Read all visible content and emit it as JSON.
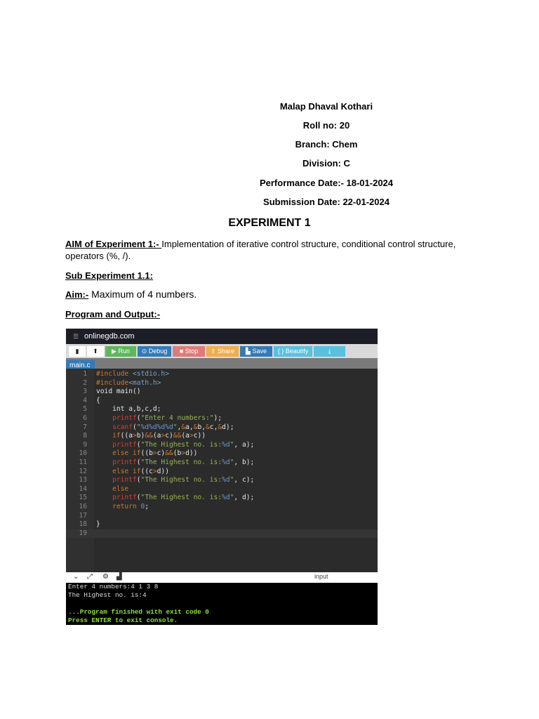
{
  "header": {
    "name": "Malap Dhaval Kothari",
    "roll": "Roll no: 20",
    "branch": "Branch: Chem",
    "division": "Division: C",
    "performance_date": "Performance Date:- 18-01-2024",
    "submission_date": "Submission Date: 22-01-2024"
  },
  "title": "EXPERIMENT 1",
  "aim": {
    "label": " AIM of Experiment 1:- ",
    "text": "Implementation of iterative control structure, conditional control structure, operators (%, /)."
  },
  "sub_experiment": " Sub Experiment 1.1:",
  "sub_aim": {
    "label": " Aim:-",
    "text": " Maximum of 4 numbers."
  },
  "program_output_label": "Program and Output:-",
  "screenshot": {
    "site": "onlinegdb.com",
    "toolbar": {
      "run": "▶ Run",
      "debug": "⊙ Debug",
      "stop": "■ Stop",
      "share": "⇪ Share",
      "save": "▙ Save",
      "beautify": "{ } Beautify",
      "download": "⤓"
    },
    "colors": {
      "run": "#5cb85c",
      "debug": "#337ab7",
      "stop": "#e07b7b",
      "share": "#f0ad4e",
      "save": "#337ab7",
      "beautify": "#5bc0de",
      "download": "#5bc0de"
    },
    "tab": "main.c",
    "code_lines": [
      [
        [
          "pp",
          "#include "
        ],
        [
          "inc",
          "<stdio.h>"
        ]
      ],
      [
        [
          "pp",
          "#include"
        ],
        [
          "inc",
          "<math.h>"
        ]
      ],
      [
        [
          "plain",
          "void main()"
        ]
      ],
      [
        [
          "plain",
          "{"
        ]
      ],
      [
        [
          "plain",
          "    int a,b,c,d;"
        ]
      ],
      [
        [
          "fn",
          "    printf"
        ],
        [
          "plain",
          "("
        ],
        [
          "str",
          "\"Enter 4 numbers:\""
        ],
        [
          "plain",
          ");"
        ]
      ],
      [
        [
          "fn",
          "    scanf"
        ],
        [
          "plain",
          "("
        ],
        [
          "str",
          "\""
        ],
        [
          "fmt",
          "%d%d%d%d"
        ],
        [
          "str",
          "\""
        ],
        [
          "plain",
          ","
        ],
        [
          "op",
          "&"
        ],
        [
          "plain",
          "a,"
        ],
        [
          "op",
          "&"
        ],
        [
          "plain",
          "b,"
        ],
        [
          "op",
          "&"
        ],
        [
          "plain",
          "c,"
        ],
        [
          "op",
          "&"
        ],
        [
          "plain",
          "d);"
        ]
      ],
      [
        [
          "kw",
          "    if"
        ],
        [
          "plain",
          "((a"
        ],
        [
          "op",
          ">"
        ],
        [
          "plain",
          "b)"
        ],
        [
          "op",
          "&&"
        ],
        [
          "plain",
          "(a"
        ],
        [
          "op",
          ">"
        ],
        [
          "plain",
          "c)"
        ],
        [
          "op",
          "&&"
        ],
        [
          "plain",
          "(a"
        ],
        [
          "op",
          ">"
        ],
        [
          "plain",
          "c))"
        ]
      ],
      [
        [
          "fn",
          "    printf"
        ],
        [
          "plain",
          "("
        ],
        [
          "str",
          "\"The Highest no. is:"
        ],
        [
          "fmt",
          "%d"
        ],
        [
          "str",
          "\""
        ],
        [
          "plain",
          ", a);"
        ]
      ],
      [
        [
          "kw",
          "    else if"
        ],
        [
          "plain",
          "((b"
        ],
        [
          "op",
          ">"
        ],
        [
          "plain",
          "c)"
        ],
        [
          "op",
          "&&"
        ],
        [
          "plain",
          "(b"
        ],
        [
          "op",
          ">"
        ],
        [
          "plain",
          "d))"
        ]
      ],
      [
        [
          "fn",
          "    printf"
        ],
        [
          "plain",
          "("
        ],
        [
          "str",
          "\"The Highest no. is:"
        ],
        [
          "fmt",
          "%d"
        ],
        [
          "str",
          "\""
        ],
        [
          "plain",
          ", b);"
        ]
      ],
      [
        [
          "kw",
          "    else if"
        ],
        [
          "plain",
          "((c"
        ],
        [
          "op",
          ">"
        ],
        [
          "plain",
          "d))"
        ]
      ],
      [
        [
          "fn",
          "    printf"
        ],
        [
          "plain",
          "("
        ],
        [
          "str",
          "\"The Highest no. is:"
        ],
        [
          "fmt",
          "%d"
        ],
        [
          "str",
          "\""
        ],
        [
          "plain",
          ", c);"
        ]
      ],
      [
        [
          "kw",
          "    else"
        ]
      ],
      [
        [
          "fn",
          "    printf"
        ],
        [
          "plain",
          "("
        ],
        [
          "str",
          "\"The Highest no. is:"
        ],
        [
          "fmt",
          "%d"
        ],
        [
          "str",
          "\""
        ],
        [
          "plain",
          ", d);"
        ]
      ],
      [
        [
          "kw",
          "    return "
        ],
        [
          "num",
          "0"
        ],
        [
          "plain",
          ";"
        ]
      ],
      [],
      [
        [
          "plain",
          "}"
        ]
      ],
      []
    ],
    "bottom_bar": {
      "input_label": "input"
    },
    "terminal": [
      "Enter 4 numbers:4 1 3 8",
      "The Highest no. is:4",
      "",
      "...Program finished with exit code 0",
      "Press ENTER to exit console."
    ]
  }
}
